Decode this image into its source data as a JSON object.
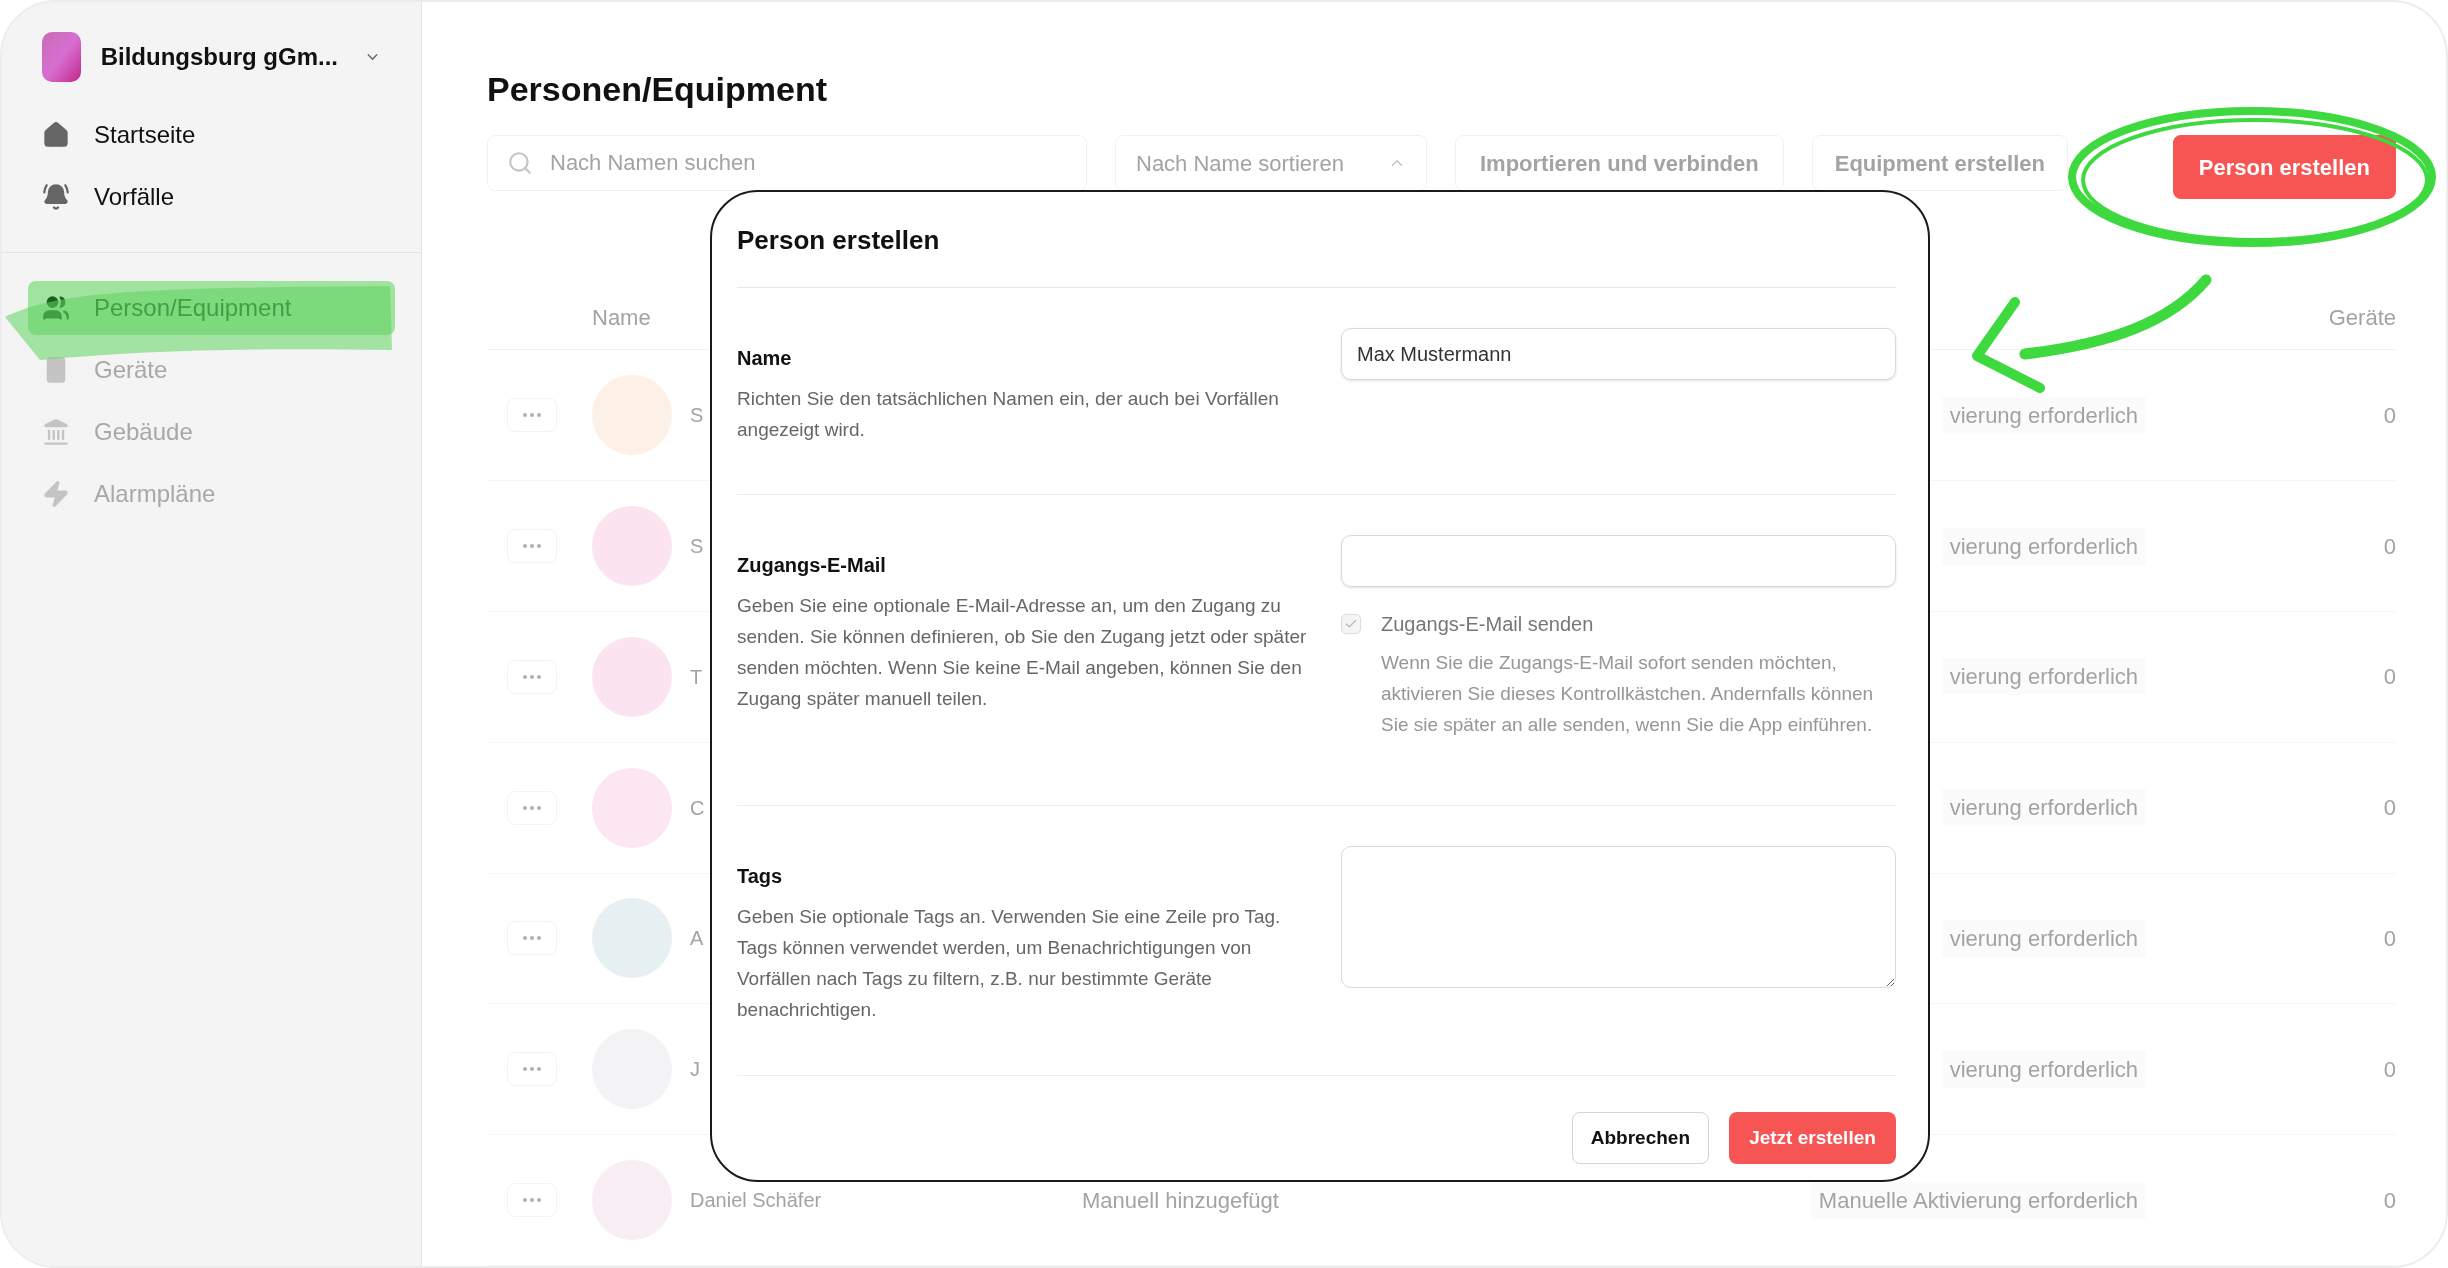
{
  "sidebar": {
    "org_name": "Bildungsburg gGm...",
    "items": [
      {
        "label": "Startseite",
        "selected": false,
        "disabled": false
      },
      {
        "label": "Vorfälle",
        "selected": false,
        "disabled": false
      },
      {
        "label": "Person/Equipment",
        "selected": true,
        "disabled": false
      },
      {
        "label": "Geräte",
        "selected": false,
        "disabled": true
      },
      {
        "label": "Gebäude",
        "selected": false,
        "disabled": true
      },
      {
        "label": "Alarmpläne",
        "selected": false,
        "disabled": true
      }
    ]
  },
  "page": {
    "title": "Personen/Equipment"
  },
  "toolbar": {
    "search": {
      "placeholder": "Nach Namen suchen"
    },
    "sort": "Nach Name sortieren",
    "import_button": "Importieren und verbinden",
    "equipment_button": "Equipment erstellen",
    "create_button": "Person erstellen"
  },
  "table": {
    "columns": [
      "Name",
      "Geräte"
    ],
    "rows": [
      {
        "name": "S",
        "status": "vierung erforderlich",
        "devices": "0",
        "color": "#fdf0e6"
      },
      {
        "name": "S",
        "status": "vierung erforderlich",
        "devices": "0",
        "color": "#fbe3ef"
      },
      {
        "name": "T",
        "status": "vierung erforderlich",
        "devices": "0",
        "color": "#fbe3ef"
      },
      {
        "name": "C",
        "status": "vierung erforderlich",
        "devices": "0",
        "color": "#fbe6f1"
      },
      {
        "name": "A",
        "status": "vierung erforderlich",
        "devices": "0",
        "color": "#e6f0f3"
      },
      {
        "name": "J",
        "status": "vierung erforderlich",
        "devices": "0",
        "color": "#f3f3f5"
      },
      {
        "name": "Daniel Schäfer",
        "source": "Manuell hinzugefügt",
        "status": "Manuelle Aktivierung erforderlich",
        "devices": "0",
        "color": "#f8eef3"
      }
    ]
  },
  "dialog": {
    "title": "Person erstellen",
    "sections": [
      {
        "kind": "input",
        "label": "Name",
        "description": "Richten Sie den tatsächlichen Namen ein, der auch bei Vorfällen angezeigt wird.",
        "value": "Max Mustermann"
      },
      {
        "kind": "email",
        "label": "Zugangs-E-Mail",
        "description": "Geben Sie eine optionale E-Mail-Adresse an, um den Zugang zu senden. Sie können definieren, ob Sie den Zugang jetzt oder später senden möchten. Wenn Sie keine E-Mail angeben, können Sie den Zugang später manuell teilen.",
        "checkbox": {
          "label": "Zugangs-E-Mail senden",
          "checked": true,
          "disabled": true,
          "help": "Wenn Sie die Zugangs-E-Mail sofort senden möchten, aktivieren Sie dieses Kontrollkästchen. Andernfalls können Sie sie später an alle senden, wenn Sie die App einführen."
        }
      },
      {
        "kind": "textarea",
        "label": "Tags",
        "description": "Geben Sie optionale Tags an. Verwenden Sie eine Zeile pro Tag. Tags können verwendet werden, um Benachrichtigungen von Vorfällen nach Tags zu filtern, z.B. nur bestimmte Geräte benachrichtigen."
      }
    ],
    "cancel_button": "Abbrechen",
    "submit_button": "Jetzt erstellen"
  }
}
